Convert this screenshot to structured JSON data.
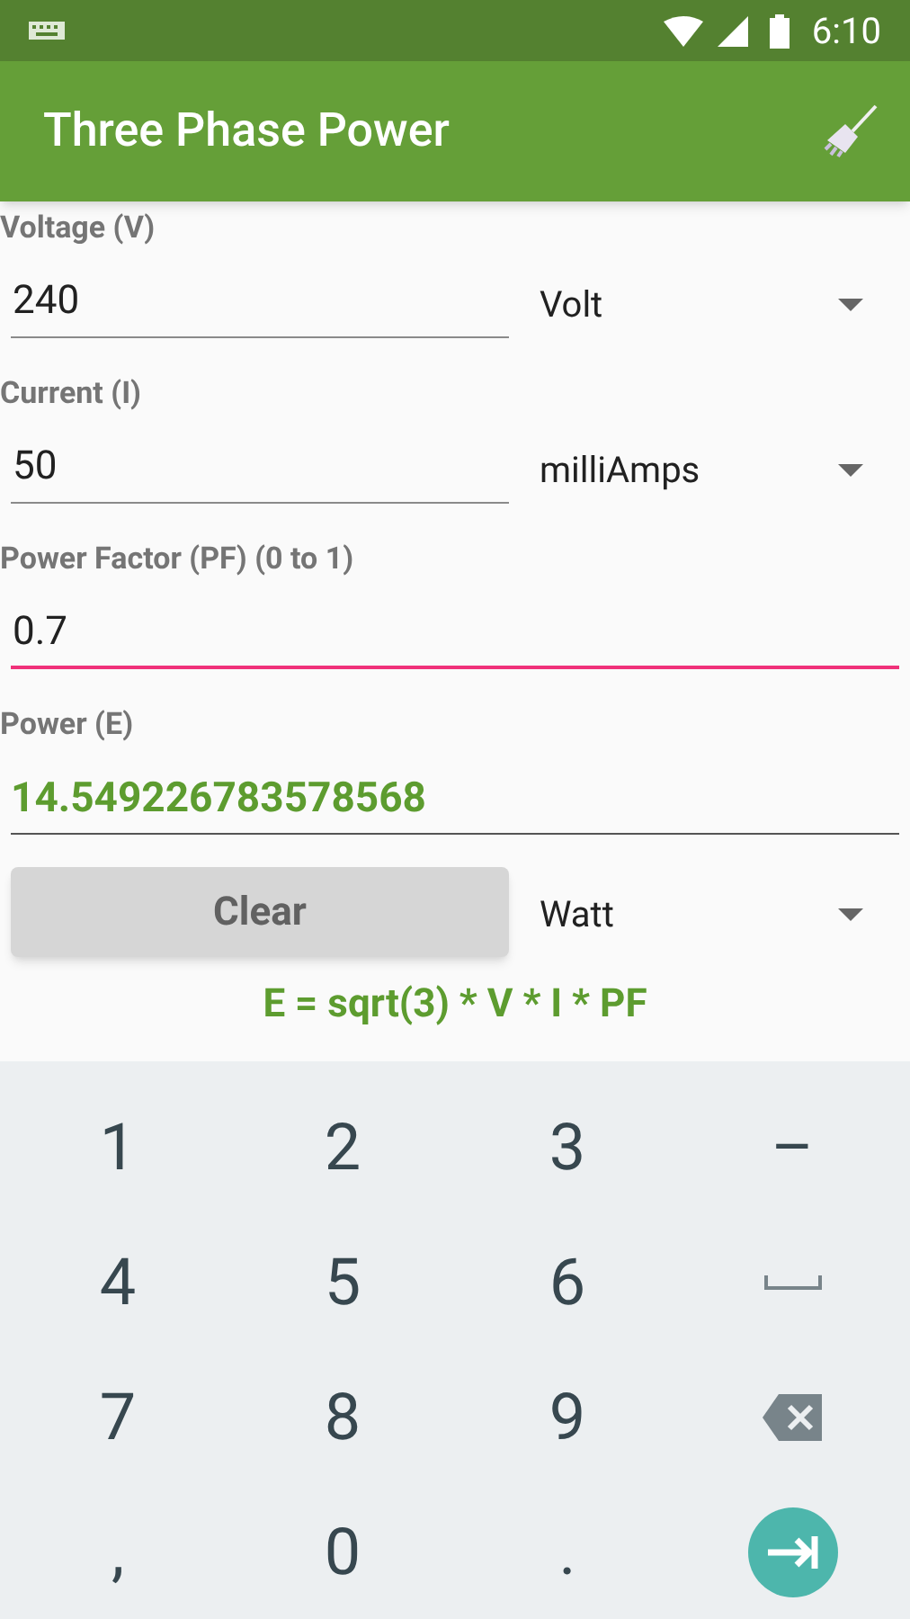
{
  "status_bar": {
    "time": "6:10"
  },
  "app_bar": {
    "title": "Three Phase Power"
  },
  "fields": [
    {
      "label": "Voltage (V)",
      "value": "240",
      "focused": false,
      "unit": "Volt"
    },
    {
      "label": "Current (I)",
      "value": "50",
      "focused": false,
      "unit": "milliAmps"
    },
    {
      "label": "Power Factor (PF) (0 to 1)",
      "value": "0.7",
      "focused": true
    }
  ],
  "result": {
    "label": "Power (E)",
    "value": "14.549226783578568"
  },
  "clear_button": {
    "label": "Clear"
  },
  "result_unit": "Watt",
  "formula": "E = sqrt(3) * V * I * PF",
  "keyboard": [
    {
      "kind": "text",
      "label": "1"
    },
    {
      "kind": "text",
      "label": "2"
    },
    {
      "kind": "text",
      "label": "3"
    },
    {
      "kind": "text",
      "label": "–"
    },
    {
      "kind": "text",
      "label": "4"
    },
    {
      "kind": "text",
      "label": "5"
    },
    {
      "kind": "text",
      "label": "6"
    },
    {
      "kind": "space"
    },
    {
      "kind": "text",
      "label": "7"
    },
    {
      "kind": "text",
      "label": "8"
    },
    {
      "kind": "text",
      "label": "9"
    },
    {
      "kind": "backspace"
    },
    {
      "kind": "text",
      "label": ","
    },
    {
      "kind": "text",
      "label": "0"
    },
    {
      "kind": "text",
      "label": "."
    },
    {
      "kind": "next"
    }
  ]
}
